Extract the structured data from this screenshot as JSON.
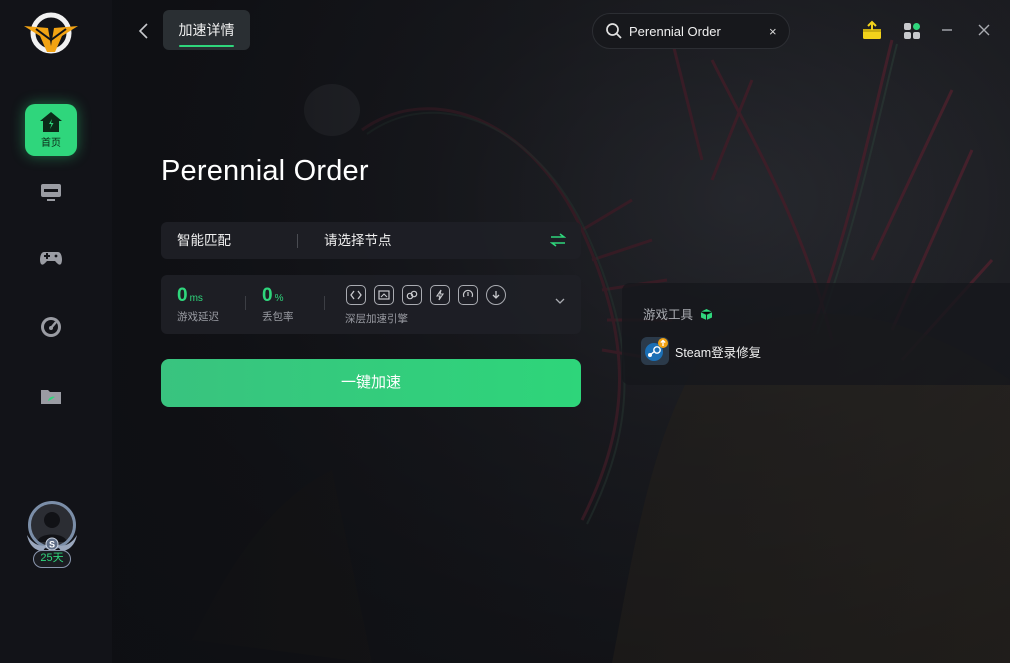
{
  "sidebar": {
    "logo_icon": "wings-v-logo-icon",
    "items": [
      {
        "icon": "home-icon",
        "label": "首页",
        "active": true
      },
      {
        "icon": "monitor-icon",
        "label": ""
      },
      {
        "icon": "gamepad-icon",
        "label": ""
      },
      {
        "icon": "speedometer-icon",
        "label": ""
      },
      {
        "icon": "folder-icon",
        "label": ""
      }
    ],
    "user": {
      "avatar_icon": "user-avatar-icon",
      "level_badge": "S",
      "days": "25天"
    }
  },
  "topbar": {
    "active_tab": "加速详情",
    "search": {
      "value": "Perennial Order",
      "clear_symbol": "×"
    },
    "window_controls": [
      "gift-box-icon",
      "apps-grid-icon",
      "minimize-icon",
      "close-icon"
    ]
  },
  "game": {
    "title": "Perennial Order",
    "match_mode": "智能匹配",
    "node_placeholder": "请选择节点",
    "stats": {
      "latency_value": "0",
      "latency_unit": "ms",
      "latency_label": "游戏延迟",
      "loss_value": "0",
      "loss_unit": "%",
      "loss_label": "丢包率",
      "engine_label": "深层加速引擎"
    },
    "accelerate_button": "一键加速"
  },
  "tools": {
    "title": "游戏工具",
    "items": [
      {
        "icon": "steam-icon",
        "label": "Steam登录修复"
      }
    ]
  },
  "colors": {
    "accent": "#2fd67c",
    "sidebar_bg": "#121318",
    "panel_bg": "#1e2026"
  }
}
